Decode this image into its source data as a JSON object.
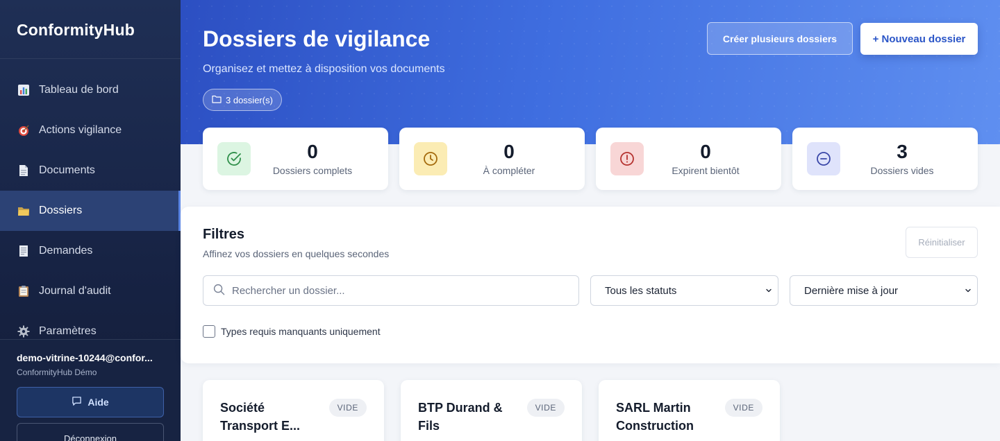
{
  "app": {
    "brand": "ConformityHub"
  },
  "sidebar": {
    "items": [
      {
        "label": "Tableau de bord",
        "icon": "chart-icon"
      },
      {
        "label": "Actions vigilance",
        "icon": "target-icon"
      },
      {
        "label": "Documents",
        "icon": "document-icon"
      },
      {
        "label": "Dossiers",
        "icon": "folder-icon",
        "active": true
      },
      {
        "label": "Demandes",
        "icon": "receipt-icon"
      },
      {
        "label": "Journal d'audit",
        "icon": "clipboard-icon"
      },
      {
        "label": "Paramètres",
        "icon": "gear-icon"
      }
    ],
    "user_email": "demo-vitrine-10244@confor...",
    "user_org": "ConformityHub Démo",
    "help_label": "Aide",
    "logout_label": "Déconnexion"
  },
  "header": {
    "title": "Dossiers de vigilance",
    "subtitle": "Organisez et mettez à disposition vos documents",
    "count_label": "3 dossier(s)",
    "btn_multi": "Créer plusieurs dossiers",
    "btn_new": "+ Nouveau dossier"
  },
  "stats": [
    {
      "value": "0",
      "label": "Dossiers complets",
      "color": "#2f8f4a",
      "bg": "#dcf5e2"
    },
    {
      "value": "0",
      "label": "À compléter",
      "color": "#a46a0c",
      "bg": "#fbecb4"
    },
    {
      "value": "0",
      "label": "Expirent bientôt",
      "color": "#b5322f",
      "bg": "#f8d6d6"
    },
    {
      "value": "3",
      "label": "Dossiers vides",
      "color": "#3a47a8",
      "bg": "#dfe3fb"
    }
  ],
  "filters": {
    "title": "Filtres",
    "subtitle": "Affinez vos dossiers en quelques secondes",
    "reset_label": "Réinitialiser",
    "search_placeholder": "Rechercher un dossier...",
    "status_value": "Tous les statuts",
    "sort_value": "Dernière mise à jour",
    "checkbox_label": "Types requis manquants uniquement"
  },
  "dossiers": [
    {
      "name": "Société Transport E...",
      "badge": "VIDE"
    },
    {
      "name": "BTP Durand & Fils",
      "badge": "VIDE"
    },
    {
      "name": "SARL Martin Construction",
      "badge": "VIDE"
    }
  ],
  "colors": {
    "accent": "#3f6ee0",
    "sidebar": "#172344",
    "active_item": "#2c4275"
  }
}
